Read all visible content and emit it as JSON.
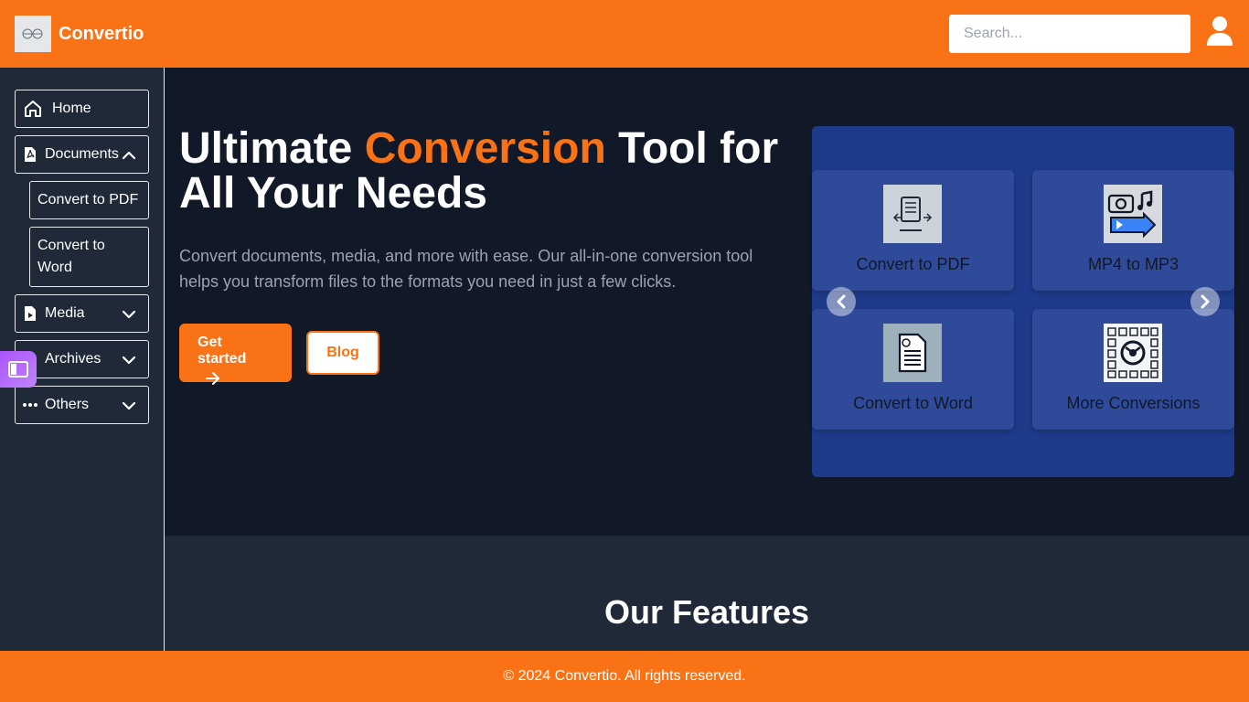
{
  "header": {
    "logo_icon": "logo-image",
    "app_name": "Convertio",
    "search_placeholder": "Search...",
    "avatar_icon": "user-icon",
    "bg_color": "#f97316"
  },
  "sidebar": {
    "items": [
      {
        "label": "Home",
        "icon": "home-icon",
        "expanded": null
      },
      {
        "label": "Documents",
        "icon": "file-pdf-icon",
        "expanded": true,
        "children": [
          {
            "label": "Convert to PDF"
          },
          {
            "label": "Convert to Word"
          }
        ]
      },
      {
        "label": "Media",
        "icon": "file-video-icon",
        "expanded": false
      },
      {
        "label": "Archives",
        "icon": "file-archive-icon",
        "expanded": false
      },
      {
        "label": "Others",
        "icon": "ellipsis-icon",
        "expanded": false
      }
    ]
  },
  "hero": {
    "title_part1": "Ultimate ",
    "title_accent": "Conversion",
    "title_part2": " Tool for All Your Needs",
    "description": "Convert documents, media, and more with ease. Our all-in-one conversion tool helps you transform files to the formats you need in just a few clicks.",
    "primary_button": "Get started",
    "secondary_button": "Blog",
    "accent_color": "#f97316"
  },
  "carousel": {
    "cards": [
      {
        "label": "Convert to PDF",
        "icon": "pdf-convert-icon"
      },
      {
        "label": "MP4 to MP3",
        "icon": "mp4-to-mp3-icon"
      },
      {
        "label": "Convert to Word",
        "icon": "word-document-icon"
      },
      {
        "label": "More Conversions",
        "icon": "more-conversions-icon"
      }
    ],
    "prev_icon": "chevron-left-icon",
    "next_icon": "chevron-right-icon",
    "bg_color": "#1e3a8a"
  },
  "features": {
    "title": "Our Features"
  },
  "footer": {
    "text": "© 2024 Convertio. All rights reserved."
  }
}
